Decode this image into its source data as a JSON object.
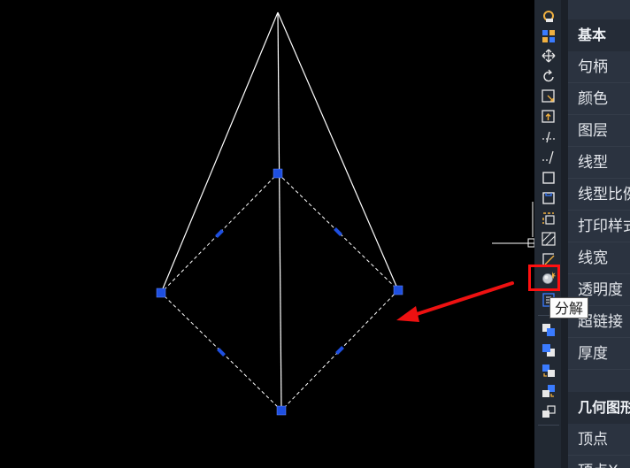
{
  "toolbar": {
    "tooltip": "分解",
    "icons": [
      "quick-select-icon",
      "select-all-icon",
      "move-icon",
      "rotate-icon",
      "scale-icon",
      "copy-icon",
      "extend-icon",
      "trim-icon",
      "rectangle-icon",
      "block-icon",
      "array-icon",
      "hatch-icon",
      "region-icon",
      "explode-icon",
      "properties-icon",
      "draw-order-front-icon",
      "draw-order-back-icon",
      "bring-above-icon",
      "send-under-icon",
      "bring-text-front-icon"
    ],
    "highlight_color": "#ff1010"
  },
  "properties": {
    "section_general": "基本",
    "general_rows": [
      "句柄",
      "颜色",
      "图层",
      "线型",
      "线型比例",
      "打印样式",
      "线宽",
      "透明度",
      "超链接",
      "厚度"
    ],
    "section_geometry": "几何图形",
    "geometry_rows": [
      "顶点",
      "顶点X"
    ]
  },
  "colors": {
    "grip": "#1e4fe0",
    "annotation_arrow": "#ee1111"
  }
}
